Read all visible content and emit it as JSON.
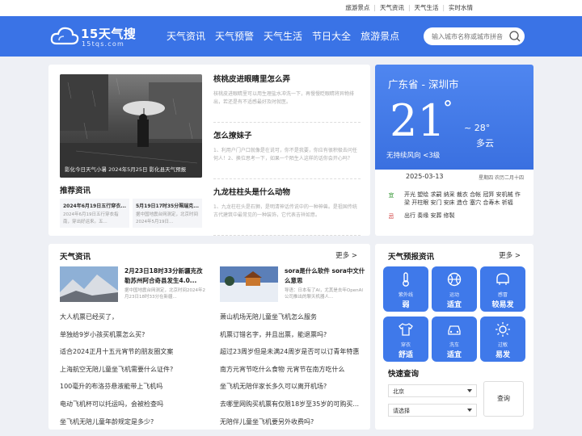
{
  "toplinks": [
    "旅游景点",
    "天气资讯",
    "天气生活",
    "实时水情"
  ],
  "logo": {
    "title": "15天气搜",
    "sub": "15tqs.com"
  },
  "nav": [
    "天气资讯",
    "天气预警",
    "天气生活",
    "节日大全",
    "旅游景点"
  ],
  "search": {
    "placeholder": "输入城市名称或城市拼音"
  },
  "feature": {
    "caption": "影化今日天气小暑 2024年5月25日 影化县天气预报"
  },
  "recommend": {
    "title": "推荐资讯",
    "items": [
      {
        "title": "2024年6月19日五行穿衣...",
        "desc": "2024年6月19日五行穿衣指南，穿出好运来。五..."
      },
      {
        "title": "5月19日17时35分珮瑞克...",
        "desc": "据中国地震台网测定，北京时间2024年5月19日..."
      }
    ]
  },
  "articles": [
    {
      "title": "核桃皮进眼睛里怎么弄",
      "desc": "核桃皮进眼睛里可以用生理盐水冲洗一下，再慢慢眨眼睛将异物排出，若还是有不适感最好及时就医。"
    },
    {
      "title": "怎么撩妹子",
      "desc": "1、利用户门户口就像是在说可，你不是我要，你应有很积极去问任何人！2、换位思考一下，如果一个陌生人这样的话你会开心吗？"
    },
    {
      "title": "九龙柱柱头是什么动物",
      "desc": "1、九龙柱柱头是石狮，是明清神话传说中的一种神兽。是祖国传统古代建筑中最常见的一种装饰，它代表吉祥如意。"
    }
  ],
  "weather": {
    "city": "广东省 - 深圳市",
    "temp": "21",
    "deg": "°",
    "hi": "~ 28°",
    "cond": "多云",
    "wind": "无持续风向  <3级",
    "date": "2025-03-13",
    "lunar": "星期四 农历二月十四",
    "yi_label": "宜",
    "yi": "开光 塑绘 求嗣 纳采 裁衣 合帐 冠笄 安机械 作梁 开柱眼 安门 安床 造仓 塞穴 合寿木 祈福",
    "ji_label": "忌",
    "ji": "出行 奏缘 安葬 修製"
  },
  "news": {
    "title": "天气资讯",
    "more": "更多 >",
    "features": [
      {
        "title": "2月23日18时33分新疆克孜勒苏州阿合奇县发生4.0...",
        "desc": "据中国地震台网测定，北京时间2024年2月23日18时33分在新疆..."
      },
      {
        "title": "sora是什么软件 sora中文什么意思",
        "desc": "导语：日本有了AI，尤其是去年OpenAI公司推出的聊天机器人..."
      }
    ],
    "left": [
      "大人机票已经买了，",
      "单独给9岁小孩买机票怎么买?",
      "适合2024正月十五元宵节的朋友圈文案",
      "上海航空无陪儿童坐飞机需要什么证件?",
      "100毫升的布洛芬悬液能带上飞机吗",
      "电动飞机杯可以托运吗，会被检查吗",
      "坐飞机无陪儿童年龄规定是多少?"
    ],
    "right": [
      "萧山机场无陪儿童坐飞机怎么服务",
      "机票订错名字，并且出票，能退票吗?",
      "超过23周岁但是未满24周岁是否可以订青年特惠",
      "南方元宵节吃什么食物 元宵节在南方吃什么",
      "坐飞机无陪伴家长多久可以离开机场?",
      "去哪里网购买机票有仅限18岁至35岁的可购买...",
      "无陪伴儿童坐飞机要另外收费吗?"
    ]
  },
  "forecast": {
    "title": "天气预报资讯",
    "more": "更多 >",
    "tiles": [
      {
        "icon": "thermometer-icon",
        "label": "紫外线",
        "value": "弱"
      },
      {
        "icon": "basketball-icon",
        "label": "运动",
        "value": "适宜"
      },
      {
        "icon": "cold-icon",
        "label": "感冒",
        "value": "较易发"
      },
      {
        "icon": "shirt-icon",
        "label": "穿衣",
        "value": "舒适"
      },
      {
        "icon": "car-icon",
        "label": "洗车",
        "value": "适宜"
      },
      {
        "icon": "sun-icon",
        "label": "过敏",
        "value": "易发"
      }
    ],
    "query_title": "快速查询",
    "province": "北京",
    "city": "请选择",
    "button": "查询"
  }
}
